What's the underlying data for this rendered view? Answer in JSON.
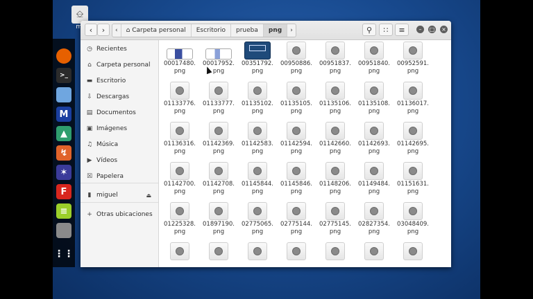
{
  "desktop_icon": {
    "label": "mi"
  },
  "window": {
    "breadcrumbs": [
      "Carpeta personal",
      "Escritorio",
      "prueba",
      "png"
    ],
    "sidebar": [
      {
        "label": "Recientes",
        "icon": "clock-icon"
      },
      {
        "label": "Carpeta personal",
        "icon": "home-icon"
      },
      {
        "label": "Escritorio",
        "icon": "desktop-icon"
      },
      {
        "label": "Descargas",
        "icon": "download-icon"
      },
      {
        "label": "Documentos",
        "icon": "document-icon"
      },
      {
        "label": "Imágenes",
        "icon": "image-icon"
      },
      {
        "label": "Música",
        "icon": "music-icon"
      },
      {
        "label": "Vídeos",
        "icon": "video-icon"
      },
      {
        "label": "Papelera",
        "icon": "trash-icon"
      },
      {
        "label": "miguel",
        "icon": "drive-icon"
      },
      {
        "label": "Otras ubicaciones",
        "icon": "plus-icon"
      }
    ],
    "files": [
      {
        "name": "00017480.",
        "ext": "png"
      },
      {
        "name": "00017952.",
        "ext": "png"
      },
      {
        "name": "00351792.",
        "ext": "png"
      },
      {
        "name": "00950886.",
        "ext": "png"
      },
      {
        "name": "00951837.",
        "ext": "png"
      },
      {
        "name": "00951840.",
        "ext": "png"
      },
      {
        "name": "00952591.",
        "ext": "png"
      },
      {
        "name": "01133776.",
        "ext": "png"
      },
      {
        "name": "01133777.",
        "ext": "png"
      },
      {
        "name": "01135102.",
        "ext": "png"
      },
      {
        "name": "01135105.",
        "ext": "png"
      },
      {
        "name": "01135106.",
        "ext": "png"
      },
      {
        "name": "01135108.",
        "ext": "png"
      },
      {
        "name": "01136017.",
        "ext": "png"
      },
      {
        "name": "01136316.",
        "ext": "png"
      },
      {
        "name": "01142369.",
        "ext": "png"
      },
      {
        "name": "01142583.",
        "ext": "png"
      },
      {
        "name": "01142594.",
        "ext": "png"
      },
      {
        "name": "01142660.",
        "ext": "png"
      },
      {
        "name": "01142693.",
        "ext": "png"
      },
      {
        "name": "01142695.",
        "ext": "png"
      },
      {
        "name": "01142700.",
        "ext": "png"
      },
      {
        "name": "01142708.",
        "ext": "png"
      },
      {
        "name": "01145844.",
        "ext": "png"
      },
      {
        "name": "01145846.",
        "ext": "png"
      },
      {
        "name": "01148206.",
        "ext": "png"
      },
      {
        "name": "01149484.",
        "ext": "png"
      },
      {
        "name": "01151631.",
        "ext": "png"
      },
      {
        "name": "01225328.",
        "ext": "png"
      },
      {
        "name": "01897190.",
        "ext": "png"
      },
      {
        "name": "02775065.",
        "ext": "png"
      },
      {
        "name": "02775144.",
        "ext": "png"
      },
      {
        "name": "02775145.",
        "ext": "png"
      },
      {
        "name": "02827354.",
        "ext": "png"
      },
      {
        "name": "03048409.",
        "ext": "png"
      }
    ]
  }
}
